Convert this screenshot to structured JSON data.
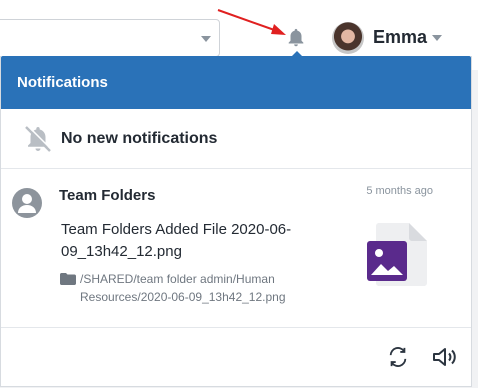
{
  "header": {
    "username": "Emma"
  },
  "panel": {
    "title": "Notifications",
    "empty_message": "No new notifications",
    "notification": {
      "sender": "Team Folders",
      "time": "5 months ago",
      "message": "Team Folders Added File 2020-06-09_13h42_12.png",
      "path": "/SHARED/team folder admin/Human Resources/2020-06-09_13h42_12.png",
      "file_type_icon": "image-file-icon"
    }
  },
  "colors": {
    "accent": "#2a72b8",
    "arrow": "#e02020",
    "file_purple": "#5a2a8c"
  }
}
